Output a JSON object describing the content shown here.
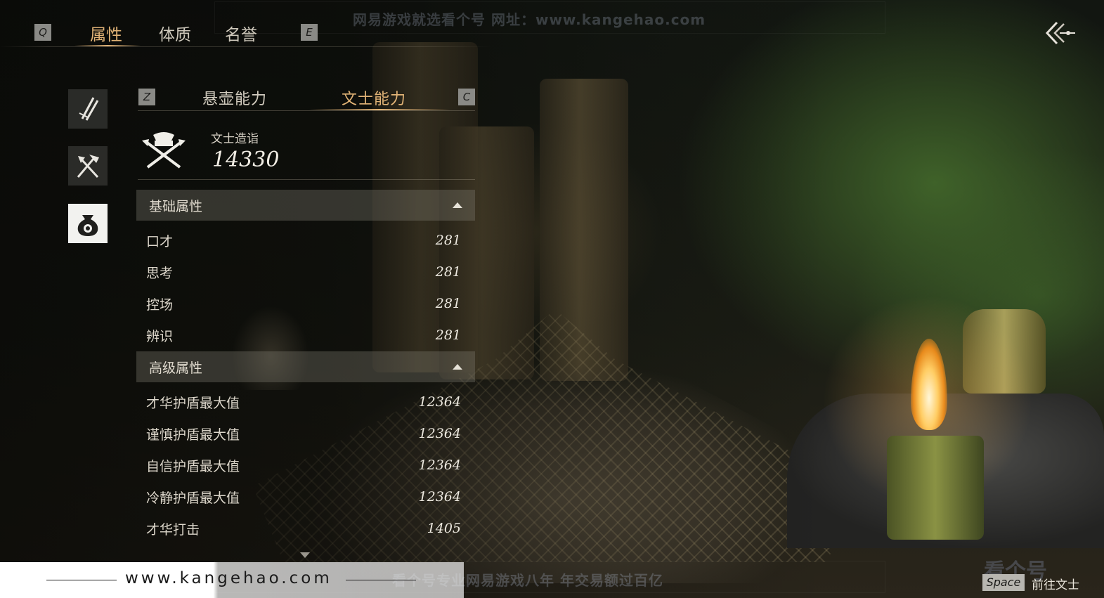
{
  "watermark": {
    "top": "网易游戏就选看个号   网址：www.kangehao.com",
    "bottom": "看个号专业网易游戏八年   年交易额过百亿",
    "logo": "看个号",
    "url": "www.kangehao.com"
  },
  "top_tabs": {
    "prev_key": "Q",
    "next_key": "E",
    "items": [
      {
        "label": "属性",
        "active": true
      },
      {
        "label": "体质",
        "active": false
      },
      {
        "label": "名誉",
        "active": false
      }
    ]
  },
  "side_icons": [
    {
      "name": "swords-icon",
      "active": false
    },
    {
      "name": "tools-icon",
      "active": false
    },
    {
      "name": "money-bag-icon",
      "active": true
    }
  ],
  "sub_tabs": {
    "prev_key": "Z",
    "next_key": "C",
    "items": [
      {
        "label": "悬壶能力",
        "active": false
      },
      {
        "label": "文士能力",
        "active": true
      }
    ]
  },
  "score": {
    "label": "文士造诣",
    "value": "14330"
  },
  "sections": [
    {
      "title": "基础属性",
      "rows": [
        {
          "name": "口才",
          "value": "281"
        },
        {
          "name": "思考",
          "value": "281"
        },
        {
          "name": "控场",
          "value": "281"
        },
        {
          "name": "辨识",
          "value": "281"
        }
      ]
    },
    {
      "title": "高级属性",
      "rows": [
        {
          "name": "才华护盾最大值",
          "value": "12364"
        },
        {
          "name": "谨慎护盾最大值",
          "value": "12364"
        },
        {
          "name": "自信护盾最大值",
          "value": "12364"
        },
        {
          "name": "冷静护盾最大值",
          "value": "12364"
        },
        {
          "name": "才华打击",
          "value": "1405"
        }
      ]
    }
  ],
  "bottom_hint": {
    "key": "Space",
    "label": "前往文士"
  },
  "colors": {
    "accent": "#e2b477",
    "panel_header": "#4a4740"
  }
}
